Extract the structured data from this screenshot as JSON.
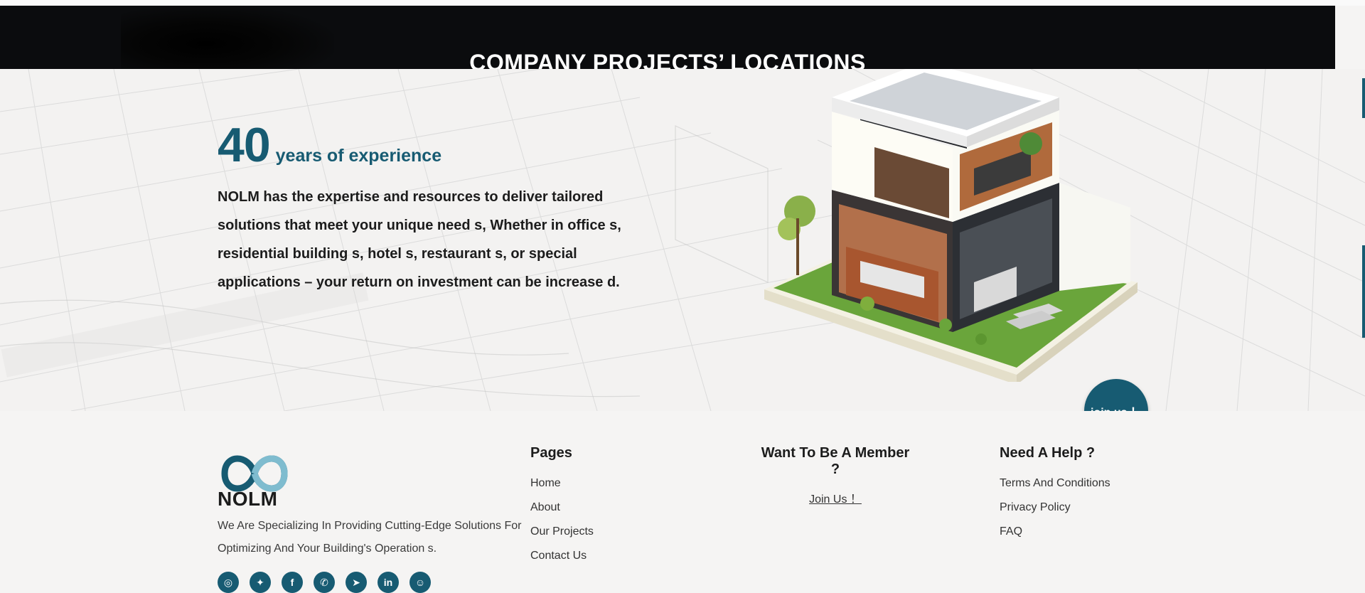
{
  "banner": {
    "title": "COMPANY PROJECTS’ LOCATIONS"
  },
  "hero": {
    "experience_number": "40",
    "experience_label": "years of experience",
    "description": "NOLM has the expertise and resources to deliver tailored solutions that meet your unique need s, Whether in office s, residential building s, hotel s, restaurant s, or special applications – your return on investment can be increase d."
  },
  "join_button": {
    "label": "join us ！"
  },
  "footer": {
    "logo_text": "NOLM",
    "tagline": "We Are Specializing In Providing Cutting-Edge Solutions For Optimizing And Your Building's Operation s.",
    "socials": [
      {
        "icon": "instagram-icon",
        "glyph": "◎"
      },
      {
        "icon": "twitter-icon",
        "glyph": "✦"
      },
      {
        "icon": "facebook-icon",
        "glyph": "f"
      },
      {
        "icon": "whatsapp-icon",
        "glyph": "✆"
      },
      {
        "icon": "telegram-icon",
        "glyph": "➤"
      },
      {
        "icon": "linkedin-icon",
        "glyph": "in"
      },
      {
        "icon": "snapchat-icon",
        "glyph": "☺"
      }
    ],
    "pages": {
      "heading": "Pages",
      "links": [
        "Home",
        "About",
        "Our Projects",
        "Contact Us"
      ]
    },
    "member": {
      "heading": "Want To Be A Member ?",
      "link": "Join Us ！"
    },
    "help": {
      "heading": "Need A Help ?",
      "links": [
        "Terms And Conditions",
        "Privacy Policy",
        "FAQ"
      ]
    }
  },
  "colors": {
    "accent": "#175b72",
    "banner_bg": "#0b0c0e",
    "page_bg": "#f5f4f3"
  }
}
